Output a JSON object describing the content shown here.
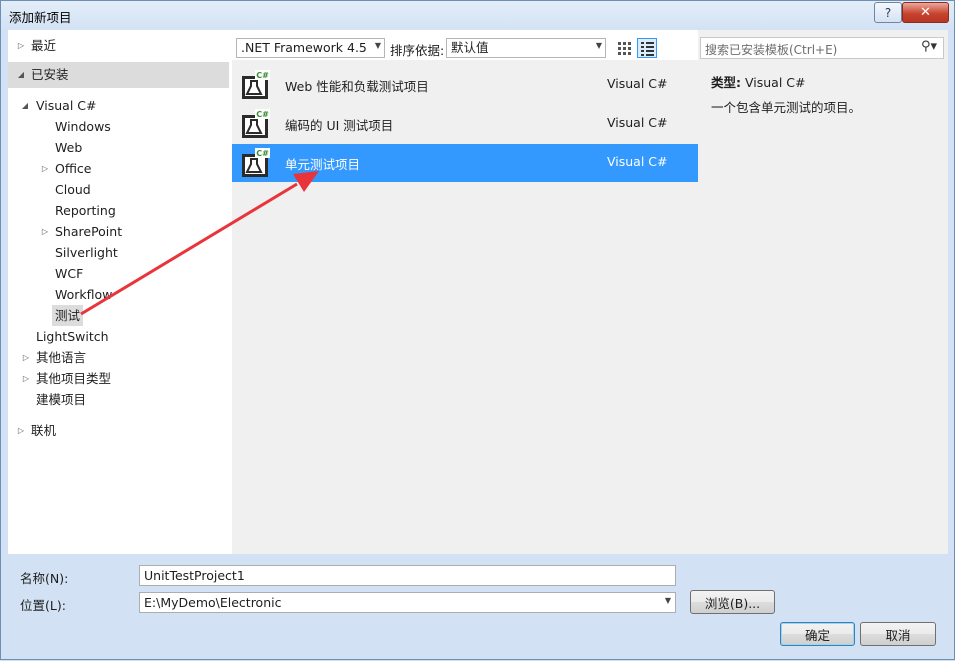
{
  "window": {
    "title": "添加新项目",
    "help": "?",
    "close": "✕"
  },
  "tree": {
    "recent": "最近",
    "installed": "已安装",
    "visual_csharp": "Visual C#",
    "items": {
      "windows": "Windows",
      "web": "Web",
      "office": "Office",
      "cloud": "Cloud",
      "reporting": "Reporting",
      "sharepoint": "SharePoint",
      "silverlight": "Silverlight",
      "wcf": "WCF",
      "workflow": "Workflow",
      "test": "测试"
    },
    "lightswitch": "LightSwitch",
    "other_languages": "其他语言",
    "other_project_types": "其他项目类型",
    "modeling_projects": "建模项目",
    "online": "联机"
  },
  "toolbar": {
    "framework": ".NET Framework 4.5",
    "sort_label": "排序依据:",
    "sort_value": "默认值"
  },
  "templates": [
    {
      "name": "Web 性能和负载测试项目",
      "lang": "Visual C#"
    },
    {
      "name": "编码的 UI 测试项目",
      "lang": "Visual C#"
    },
    {
      "name": "单元测试项目",
      "lang": "Visual C#"
    }
  ],
  "details": {
    "search_placeholder": "搜索已安装模板(Ctrl+E)",
    "type_label": "类型:",
    "type_value": "Visual C#",
    "description": "一个包含单元测试的项目。"
  },
  "form": {
    "name_label": "名称(N):",
    "name_value": "UnitTestProject1",
    "location_label": "位置(L):",
    "location_value": "E:\\MyDemo\\Electronic",
    "browse": "浏览(B)...",
    "ok": "确定",
    "cancel": "取消"
  },
  "colors": {
    "selection": "#3399ff",
    "annotation_arrow": "#e8343a"
  }
}
